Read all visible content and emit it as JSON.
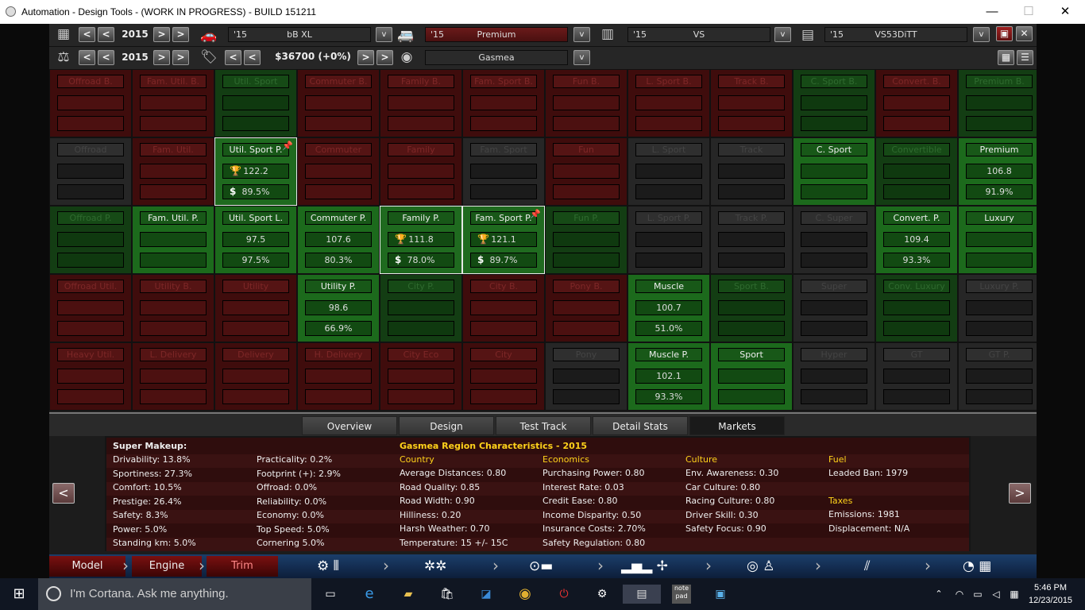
{
  "window": {
    "title": "Automation - Design Tools - (WORK IN PROGRESS) - BUILD 151211",
    "minimize": "—",
    "maximize": "☐",
    "close": "✕"
  },
  "toolbar": {
    "year1": "2015",
    "year2": "2015",
    "car1": {
      "year": "'15",
      "name": "bB XL"
    },
    "car2": {
      "year": "'15",
      "name": "Premium"
    },
    "car3": {
      "year": "'15",
      "name": "VS"
    },
    "car4": {
      "year": "'15",
      "name": "VS53DiTT"
    },
    "price": "$36700 (+0%)",
    "region": "Gasmea"
  },
  "grid": [
    [
      {
        "l": "Offroad B.",
        "s": "r"
      },
      {
        "l": "Fam. Util. B.",
        "s": "r"
      },
      {
        "l": "Util. Sport",
        "s": "g"
      },
      {
        "l": "Commuter B.",
        "s": "r"
      },
      {
        "l": "Family B.",
        "s": "r"
      },
      {
        "l": "Fam. Sport B.",
        "s": "r"
      },
      {
        "l": "Fun B.",
        "s": "r"
      },
      {
        "l": "L. Sport B.",
        "s": "r"
      },
      {
        "l": "Track B.",
        "s": "r"
      },
      {
        "l": "C. Sport B.",
        "s": "g"
      },
      {
        "l": "Convert. B.",
        "s": "r"
      },
      {
        "l": "Premium B.",
        "s": "g"
      }
    ],
    [
      {
        "l": "Offroad",
        "s": "d"
      },
      {
        "l": "Fam. Util.",
        "s": "r"
      },
      {
        "l": "Util. Sport P.",
        "s": "sel",
        "a": "122.2",
        "b": "89.5%",
        "icons": true,
        "pin": true
      },
      {
        "l": "Commuter",
        "s": "r"
      },
      {
        "l": "Family",
        "s": "r"
      },
      {
        "l": "Fam. Sport",
        "s": "d"
      },
      {
        "l": "Fun",
        "s": "r"
      },
      {
        "l": "L. Sport",
        "s": "d"
      },
      {
        "l": "Track",
        "s": "d"
      },
      {
        "l": "C. Sport",
        "s": "b"
      },
      {
        "l": "Convertible",
        "s": "g"
      },
      {
        "l": "Premium",
        "s": "b",
        "a": "106.8",
        "b": "91.9%"
      }
    ],
    [
      {
        "l": "Offroad P.",
        "s": "g"
      },
      {
        "l": "Fam. Util. P.",
        "s": "b"
      },
      {
        "l": "Util. Sport L.",
        "s": "b",
        "a": "97.5",
        "b": "97.5%"
      },
      {
        "l": "Commuter P.",
        "s": "b",
        "a": "107.6",
        "b": "80.3%"
      },
      {
        "l": "Family P.",
        "s": "sel",
        "a": "111.8",
        "b": "78.0%",
        "icons": true
      },
      {
        "l": "Fam. Sport P.",
        "s": "sel",
        "a": "121.1",
        "b": "89.7%",
        "icons": true,
        "pin": true
      },
      {
        "l": "Fun P.",
        "s": "g"
      },
      {
        "l": "L. Sport P.",
        "s": "d"
      },
      {
        "l": "Track P.",
        "s": "d"
      },
      {
        "l": "C. Super",
        "s": "d"
      },
      {
        "l": "Convert. P.",
        "s": "b",
        "a": "109.4",
        "b": "93.3%"
      },
      {
        "l": "Luxury",
        "s": "b"
      }
    ],
    [
      {
        "l": "Offroad Util.",
        "s": "r"
      },
      {
        "l": "Utility B.",
        "s": "r"
      },
      {
        "l": "Utility",
        "s": "r"
      },
      {
        "l": "Utility P.",
        "s": "b",
        "a": "98.6",
        "b": "66.9%"
      },
      {
        "l": "City P.",
        "s": "g"
      },
      {
        "l": "City B.",
        "s": "r"
      },
      {
        "l": "Pony B.",
        "s": "r"
      },
      {
        "l": "Muscle",
        "s": "b",
        "a": "100.7",
        "b": "51.0%"
      },
      {
        "l": "Sport B.",
        "s": "g"
      },
      {
        "l": "Super",
        "s": "d"
      },
      {
        "l": "Conv. Luxury",
        "s": "g"
      },
      {
        "l": "Luxury P.",
        "s": "d"
      }
    ],
    [
      {
        "l": "Heavy Util.",
        "s": "r"
      },
      {
        "l": "L. Delivery",
        "s": "r"
      },
      {
        "l": "Delivery",
        "s": "r"
      },
      {
        "l": "H. Delivery",
        "s": "r"
      },
      {
        "l": "City Eco",
        "s": "r"
      },
      {
        "l": "City",
        "s": "r"
      },
      {
        "l": "Pony",
        "s": "d"
      },
      {
        "l": "Muscle P.",
        "s": "b",
        "a": "102.1",
        "b": "93.3%"
      },
      {
        "l": "Sport",
        "s": "b"
      },
      {
        "l": "Hyper",
        "s": "d"
      },
      {
        "l": "GT",
        "s": "d"
      },
      {
        "l": "GT P.",
        "s": "d"
      }
    ]
  ],
  "tabs": [
    "Overview",
    "Design",
    "Test Track",
    "Detail Stats",
    "Markets"
  ],
  "panel": {
    "heading1": "Super Makeup:",
    "heading2": "Gasmea Region Characteristics - 2015",
    "col1": [
      "Drivability: 13.8%",
      "Sportiness: 27.3%",
      "Comfort: 10.5%",
      "Prestige: 26.4%",
      "Safety: 8.3%",
      "Power: 5.0%",
      "Standing km: 5.0%"
    ],
    "col2": [
      "Practicality: 0.2%",
      "Footprint (+): 2.9%",
      "Offroad: 0.0%",
      "Reliability: 0.0%",
      "Economy: 0.0%",
      "Top Speed: 5.0%",
      "Cornering 5.0%"
    ],
    "col3h": "Country",
    "col3": [
      "Average Distances: 0.80",
      "Road Quality: 0.85",
      "Road Width: 0.90",
      "Hilliness: 0.20",
      "Harsh Weather: 0.70",
      "Temperature: 15 +/- 15C"
    ],
    "col4h": "Economics",
    "col4": [
      "Purchasing Power: 0.80",
      "Interest Rate: 0.03",
      "Credit Ease: 0.80",
      "Income Disparity: 0.50",
      "Insurance Costs: 2.70%",
      "Safety Regulation: 0.80"
    ],
    "col5h": "Culture",
    "col5": [
      "Env. Awareness: 0.30",
      "Car Culture: 0.80",
      "Racing Culture: 0.80",
      "Driver Skill: 0.30",
      "Safety Focus: 0.90"
    ],
    "col6h": "Fuel",
    "col6a": "Leaded Ban: 1979",
    "col6h2": "Taxes",
    "col6b": [
      "Emissions: 1981",
      "Displacement: N/A"
    ]
  },
  "bottom": {
    "model": "Model",
    "engine": "Engine",
    "trim": "Trim"
  },
  "taskbar": {
    "search": "I'm Cortana. Ask me anything.",
    "time": "5:46 PM",
    "date": "12/23/2015",
    "notepad": "note pad"
  }
}
